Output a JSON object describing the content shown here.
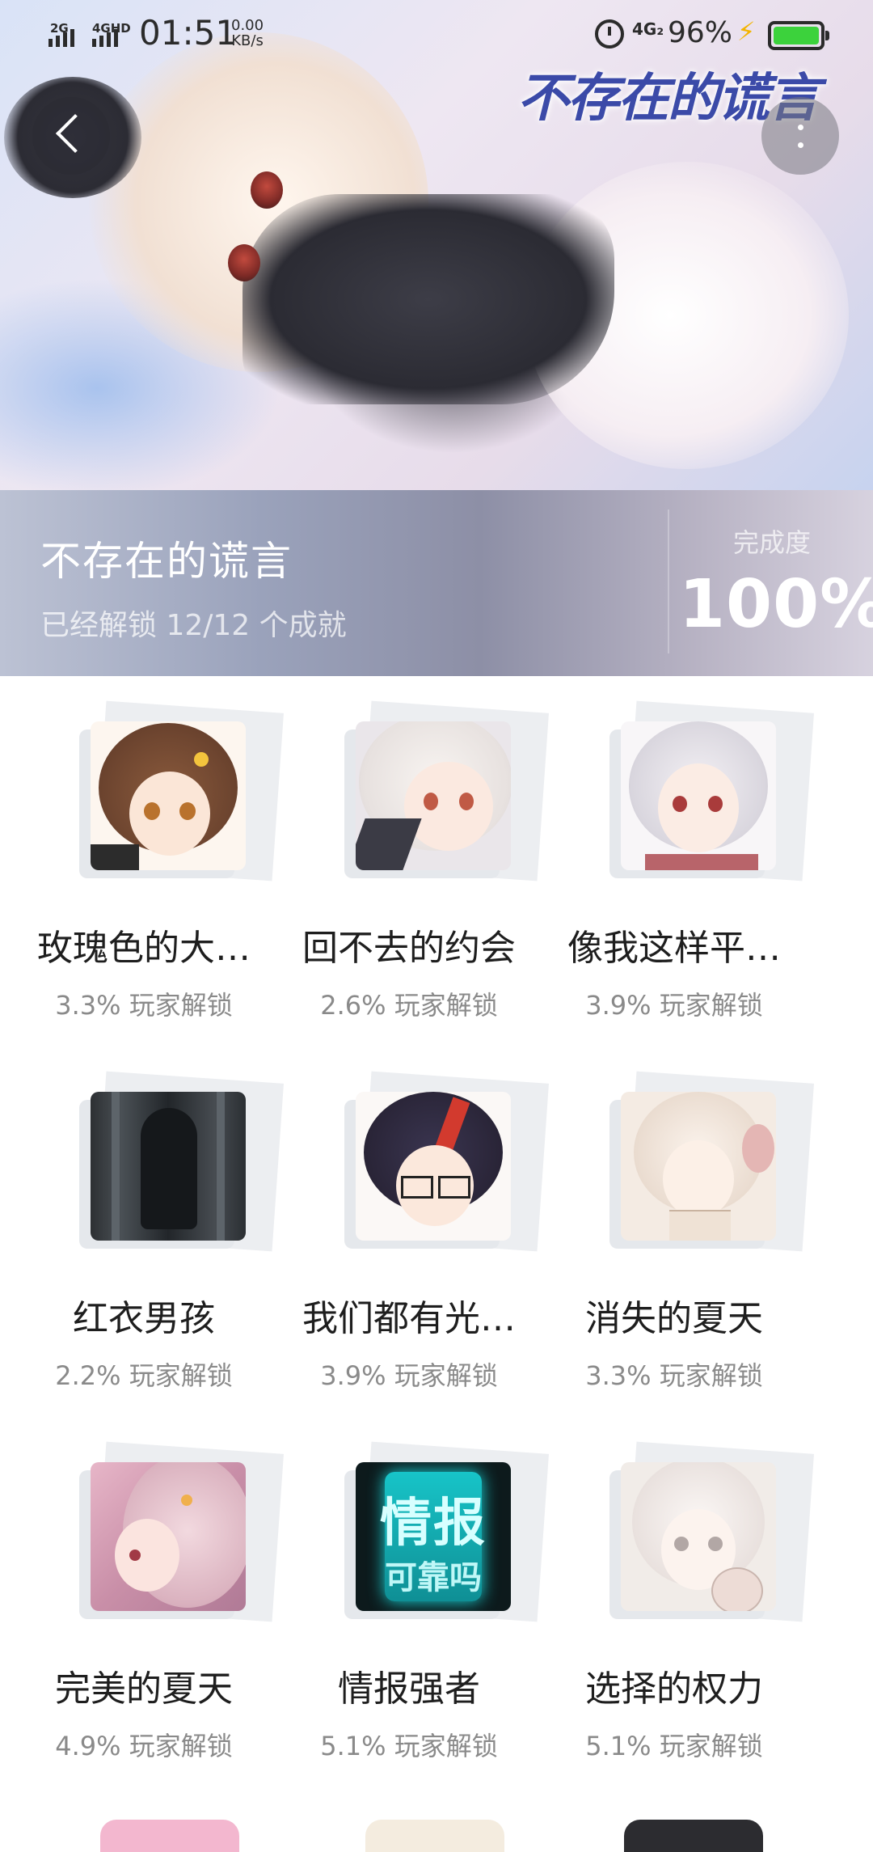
{
  "status_bar": {
    "net1": "2G",
    "net2": "4GHD",
    "time": "01:51",
    "speed_value": "0.00",
    "speed_unit": "KB/s",
    "net3": "4G₂",
    "battery": "96%",
    "battery_level": 0.96,
    "colors": {
      "battery_fill": "#3cd23c",
      "bolt": "#f3b400"
    }
  },
  "header": {
    "logo_text": "不存在的谎言",
    "game_title": "不存在的谎言",
    "unlock_summary": "已经解锁 12/12 个成就",
    "progress_label": "完成度",
    "progress_value": "100%",
    "back_icon": "chevron-left-icon",
    "more_icon": "more-vertical-icon"
  },
  "achievements": [
    {
      "name": "玫瑰色的大…",
      "rate": "3.3% 玩家解锁",
      "art": "brown-hair-girl"
    },
    {
      "name": "回不去的约会",
      "rate": "2.6% 玩家解锁",
      "art": "white-hair-girl"
    },
    {
      "name": "像我这样平…",
      "rate": "3.9% 玩家解锁",
      "art": "silver-hair-girl"
    },
    {
      "name": "红衣男孩",
      "rate": "2.2% 玩家解锁",
      "art": "dark-window-figure"
    },
    {
      "name": "我们都有光…",
      "rate": "3.9% 玩家解锁",
      "art": "boy-with-glasses"
    },
    {
      "name": "消失的夏天",
      "rate": "3.3% 玩家解锁",
      "art": "sketch-girl"
    },
    {
      "name": "完美的夏天",
      "rate": "4.9% 玩家解锁",
      "art": "pink-hair-girl"
    },
    {
      "name": "情报强者",
      "rate": "5.1% 玩家解锁",
      "art": "info-card",
      "art_text_1": "情报",
      "art_text_2": "可靠吗"
    },
    {
      "name": "选择的权力",
      "rate": "5.1% 玩家解锁",
      "art": "sketch-white-girl"
    }
  ]
}
